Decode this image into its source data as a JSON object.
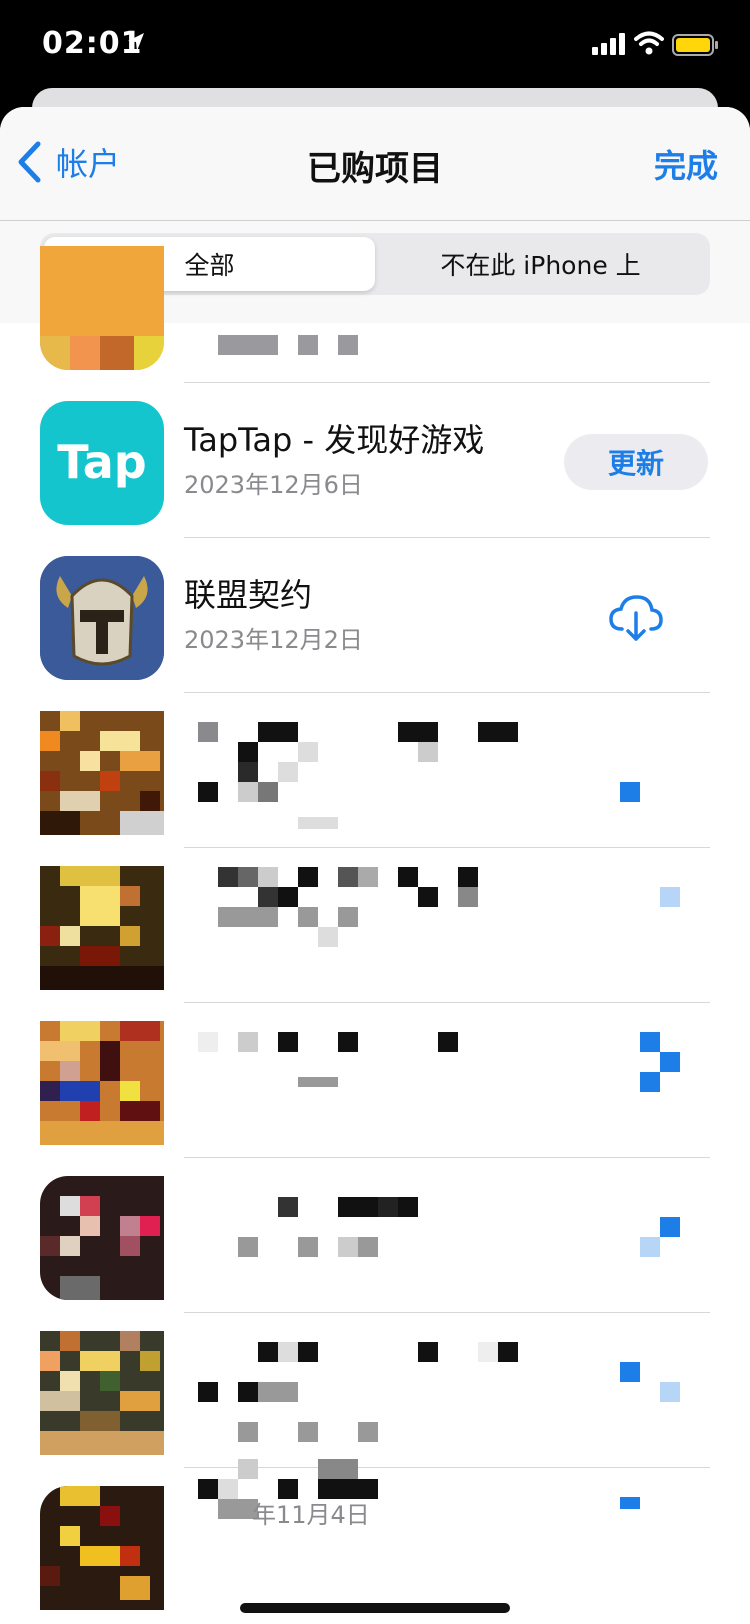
{
  "status_bar": {
    "time": "02:01"
  },
  "nav": {
    "back_label": "帐户",
    "title": "已购项目",
    "done_label": "完成"
  },
  "segments": [
    {
      "label": "全部",
      "selected": true
    },
    {
      "label": "不在此 iPhone 上",
      "selected": false
    }
  ],
  "apps": [
    {
      "name": "",
      "date": "",
      "action": "censored"
    },
    {
      "name": "TapTap - 发现好游戏",
      "date": "2023年12月6日",
      "action": "update",
      "action_label": "更新",
      "icon": "taptap-app-icon"
    },
    {
      "name": "联盟契约",
      "date": "2023年12月2日",
      "action": "download",
      "icon": "knight-helmet-app-icon"
    },
    {
      "name": "",
      "date": "",
      "action": "censored"
    },
    {
      "name": "",
      "date": "",
      "action": "censored"
    },
    {
      "name": "",
      "date": "",
      "action": "censored"
    },
    {
      "name": "",
      "date": "",
      "action": "censored"
    },
    {
      "name": "",
      "date": "",
      "action": "censored"
    },
    {
      "name": "",
      "date": "年11月4日",
      "action": "censored"
    }
  ],
  "colors": {
    "accent": "#1d7ee8",
    "taptap": "#15c5ce"
  }
}
